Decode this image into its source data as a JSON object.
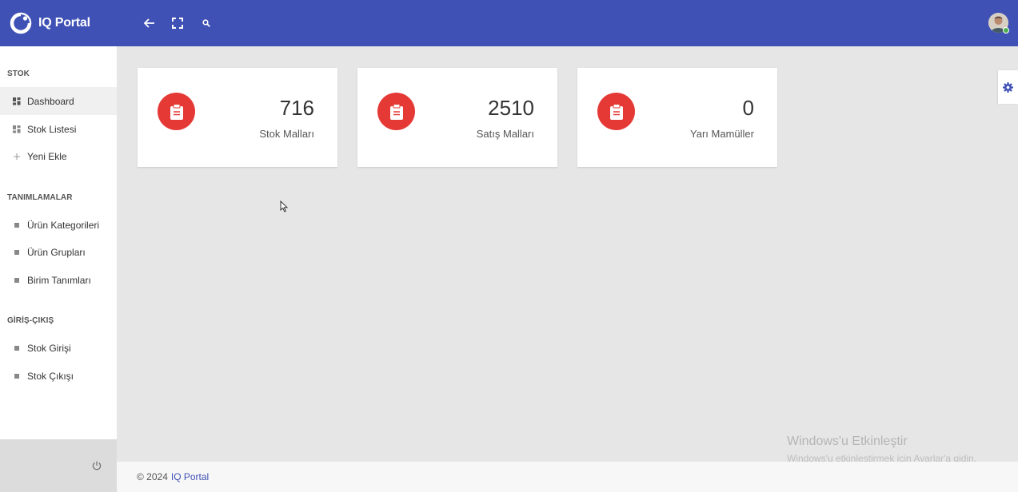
{
  "app": {
    "title": "IQ Portal"
  },
  "header": {
    "tools": [
      "back-arrow-icon",
      "fullscreen-icon",
      "search-icon"
    ]
  },
  "sidebar": {
    "sections": [
      {
        "title": "STOK",
        "items": [
          {
            "label": "Dashboard",
            "icon": "dashboard-icon",
            "active": true
          },
          {
            "label": "Stok Listesi",
            "icon": "dashboard-icon"
          },
          {
            "label": "Yeni Ekle",
            "icon": "plus-icon"
          }
        ]
      },
      {
        "title": "TANIMLAMALAR",
        "items": [
          {
            "label": "Ürün Kategorileri",
            "icon": "square-bullet-icon"
          },
          {
            "label": "Ürün Grupları",
            "icon": "square-bullet-icon"
          },
          {
            "label": "Birim Tanımları",
            "icon": "square-bullet-icon"
          }
        ]
      },
      {
        "title": "GİRİŞ-ÇIKIŞ",
        "items": [
          {
            "label": "Stok Girişi",
            "icon": "square-bullet-icon"
          },
          {
            "label": "Stok Çıkışı",
            "icon": "square-bullet-icon"
          }
        ]
      }
    ]
  },
  "cards": [
    {
      "value": "716",
      "label": "Stok Malları",
      "icon": "clipboard-icon"
    },
    {
      "value": "2510",
      "label": "Satış Malları",
      "icon": "clipboard-icon"
    },
    {
      "value": "0",
      "label": "Yarı Mamüller",
      "icon": "clipboard-icon"
    }
  ],
  "watermark": {
    "title": "Windows'u Etkinleştir",
    "subtitle": "Windows'u etkinleştirmek için Ayarlar'a gidin."
  },
  "footer": {
    "copyright": "© 2024",
    "link": "IQ Portal"
  },
  "colors": {
    "primary": "#3f51b5",
    "accent": "#e53935",
    "online": "#4caf50"
  }
}
